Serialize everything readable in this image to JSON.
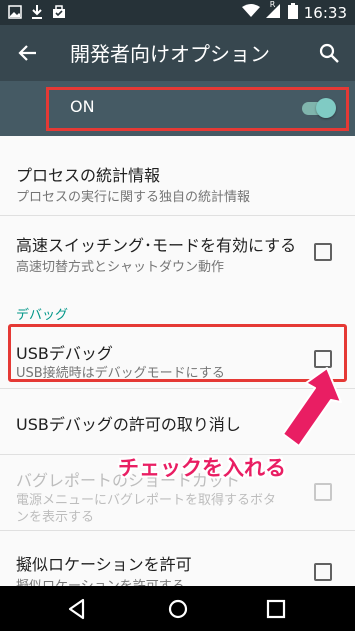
{
  "status_bar": {
    "time": "16:33",
    "signal_badge": "R",
    "left_icons": [
      "image-icon",
      "download-icon",
      "bag-icon"
    ],
    "right_icons": [
      "wifi-icon",
      "cell-signal-icon",
      "battery-icon"
    ]
  },
  "app_bar": {
    "title": "開発者向けオプション",
    "back_icon": "arrow-left-icon",
    "search_icon": "search-icon"
  },
  "master_switch": {
    "label": "ON",
    "state": true
  },
  "items": [
    {
      "title": "プロセスの統計情報",
      "subtitle": "プロセスの実行に関する独自の統計情報"
    },
    {
      "title": "高速スイッチング･モードを有効にする",
      "subtitle": "高速切替方式とシャットダウン動作",
      "checked": false
    },
    {
      "title": "USBデバッグ",
      "subtitle": "USB接続時はデバッグモードにする",
      "checked": false
    },
    {
      "title": "USBデバッグの許可の取り消し"
    },
    {
      "title": "バグレポートのショートカット",
      "subtitle_line1": "電源メニューにバグレポートを取得するボタ",
      "subtitle_line2": "ンを表示する",
      "checked": false,
      "enabled": false
    },
    {
      "title": "擬似ロケーションを許可",
      "subtitle": "擬似ロケーションを許可する",
      "checked": false
    }
  ],
  "category": "デバッグ",
  "annotation": "チェックを入れる",
  "colors": {
    "status_bar": "#263238",
    "app_bar": "#37474f",
    "switch_bar": "#455a64",
    "accent": "#009688",
    "highlight": "#e53935",
    "annotation": "#e91e63"
  },
  "nav_icons": [
    "back-triangle-icon",
    "home-circle-icon",
    "recents-square-icon"
  ]
}
